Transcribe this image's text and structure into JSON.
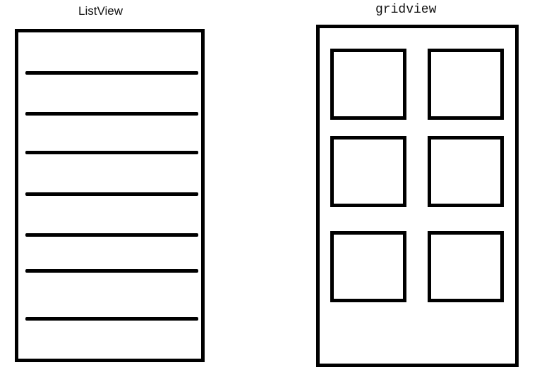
{
  "list_view": {
    "title": "ListView",
    "row_count": 7
  },
  "grid_view": {
    "title": "gridview",
    "columns": 2,
    "rows": 3,
    "cell_count": 6
  },
  "colors": {
    "stroke": "#000000",
    "background": "#ffffff"
  }
}
